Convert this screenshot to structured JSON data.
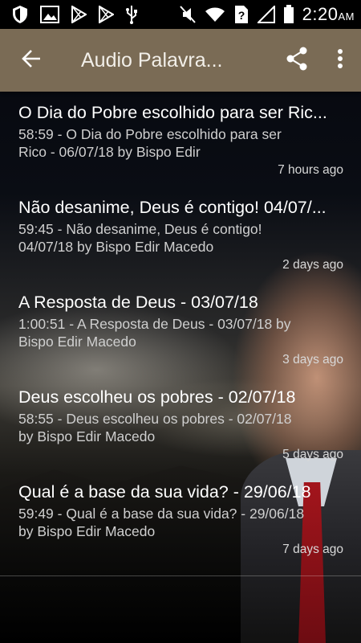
{
  "status_bar": {
    "time": "2:20",
    "ampm": "AM",
    "left_icons": [
      "shield-icon",
      "image-icon",
      "play-store-icon",
      "play-store-icon",
      "usb-icon"
    ],
    "right_icons": [
      "mute-icon",
      "wifi-icon",
      "sim-unknown-icon",
      "signal-icon",
      "battery-icon"
    ]
  },
  "toolbar": {
    "title": "Audio Palavra...",
    "color": "#7a6b55",
    "icons": [
      "back-arrow-icon",
      "share-icon",
      "more-vert-icon"
    ]
  },
  "list": [
    {
      "title": "O Dia do Pobre escolhido para ser Ric...",
      "description": "58:59 - O Dia do Pobre escolhido para ser Rico - 06/07/18 by Bispo Edir",
      "time": "7 hours ago"
    },
    {
      "title": "Não desanime, Deus é contigo! 04/07/...",
      "description": "59:45 - Não desanime, Deus é contigo! 04/07/18 by Bispo Edir Macedo",
      "time": "2 days ago"
    },
    {
      "title": "A Resposta de Deus - 03/07/18",
      "description": "1:00:51 - A Resposta de Deus - 03/07/18 by Bispo Edir Macedo",
      "time": "3 days ago"
    },
    {
      "title": "Deus escolheu os pobres - 02/07/18",
      "description": "58:55 - Deus escolheu os pobres - 02/07/18 by Bispo Edir Macedo",
      "time": "5 days ago"
    },
    {
      "title": "Qual é a base da sua vida? - 29/06/18",
      "description": "59:49 - Qual é a base da sua vida? - 29/06/18 by Bispo Edir Macedo",
      "time": "7 days ago"
    }
  ]
}
